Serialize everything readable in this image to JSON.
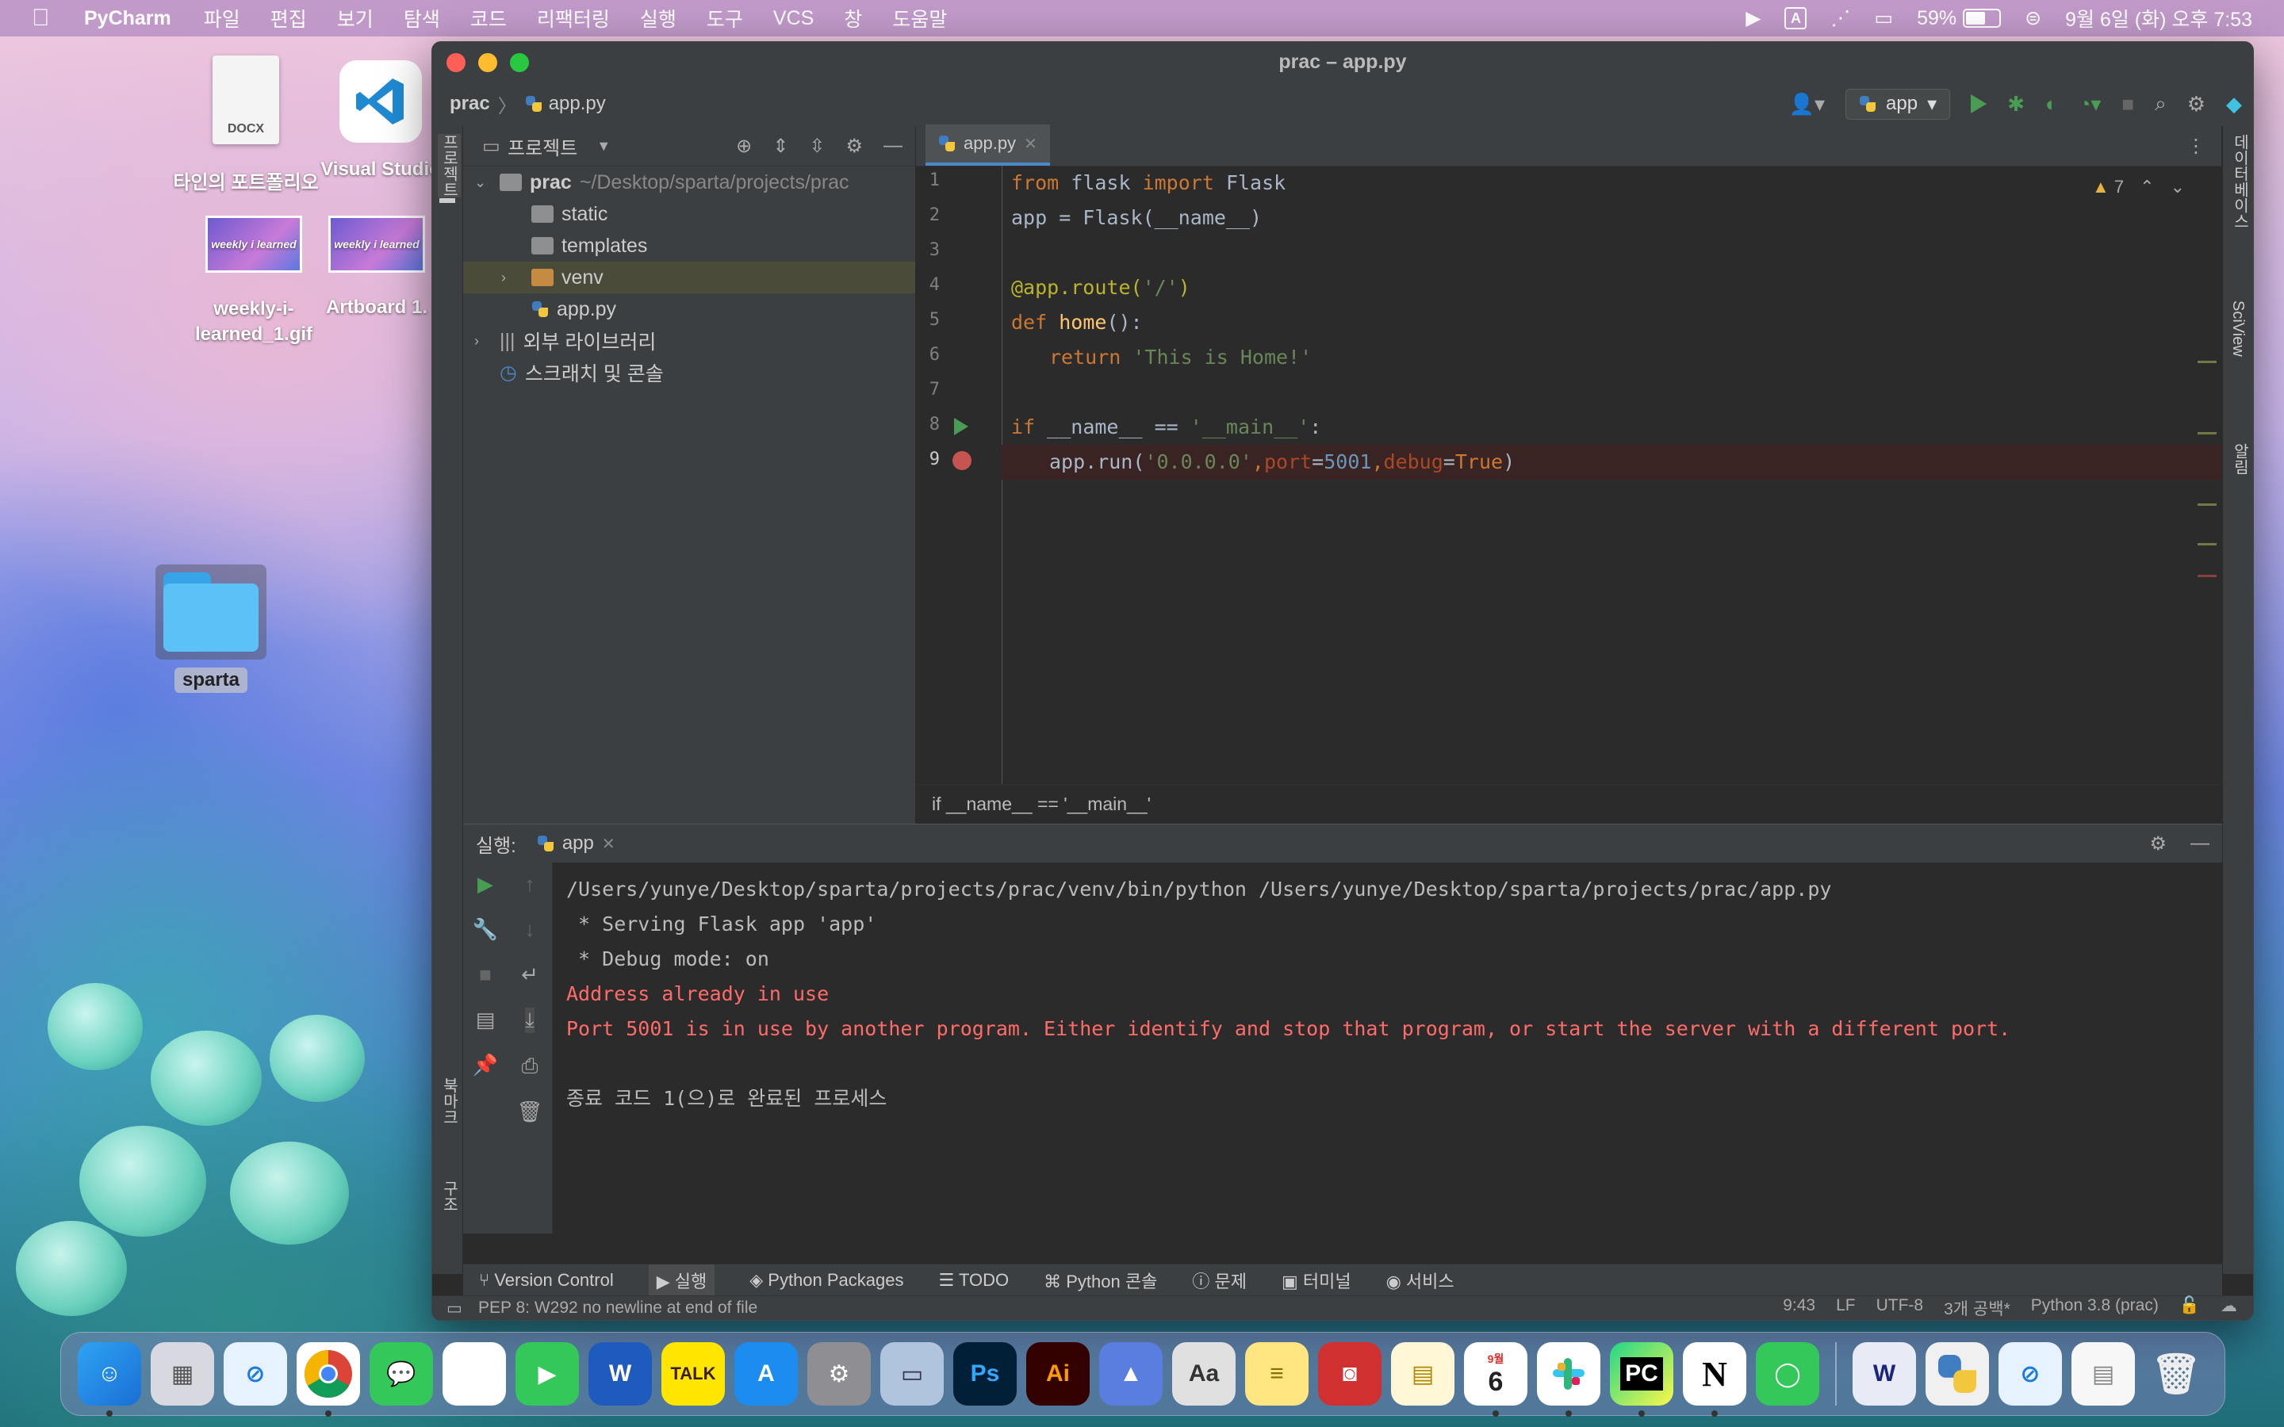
{
  "menubar": {
    "app_name": "PyCharm",
    "items": [
      "파일",
      "편집",
      "보기",
      "탐색",
      "코드",
      "리팩터링",
      "실행",
      "도구",
      "VCS",
      "창",
      "도움말"
    ],
    "input_source": "A",
    "battery_percent": "59%",
    "battery_level": 0.59,
    "clock": "9월 6일 (화) 오후 7:53"
  },
  "desktop": {
    "docx_label": "타인의 포트폴리오",
    "docx_tag": "DOCX",
    "vscode_label": "Visual Studio",
    "gif_label": "weekly-i-learned_1.gif",
    "artboard_label": "Artboard 1.",
    "folder_label": "sparta"
  },
  "window": {
    "title": "prac – app.py",
    "breadcrumb_root": "prac",
    "breadcrumb_file": "app.py",
    "run_config": "app"
  },
  "sidebar": {
    "project_label": "프로젝트",
    "bookmarks_label": "북마크",
    "structure_label": "구조",
    "right_db": "데이터베이스",
    "right_sciview": "SciView",
    "right_notify": "알림"
  },
  "project": {
    "header": "프로젝트",
    "root_name": "prac",
    "root_path": "~/Desktop/sparta/projects/prac",
    "items": [
      "static",
      "templates",
      "venv",
      "app.py"
    ],
    "external_libs": "외부 라이브러리",
    "scratches": "스크래치 및 콘솔"
  },
  "editor": {
    "tab": "app.py",
    "warning_count": "7",
    "line_numbers": [
      "1",
      "2",
      "3",
      "4",
      "5",
      "6",
      "7",
      "8",
      "9"
    ],
    "lines": [
      [
        "from",
        " flask ",
        "import",
        " Flask"
      ],
      [
        "app = Flask(__name__)"
      ],
      [
        ""
      ],
      [
        "@app.route",
        "(",
        "'/'",
        ")"
      ],
      [
        "def",
        " ",
        "home",
        "():"
      ],
      [
        "return",
        " ",
        "'This is Home!'"
      ],
      [
        ""
      ],
      [
        "if",
        " __name__ == ",
        "'__main__'",
        ":"
      ],
      [
        "app.run(",
        "'0.0.0.0'",
        ",",
        "port",
        "=",
        "5001",
        ",",
        "debug",
        "=",
        "True",
        ")"
      ]
    ],
    "breadcrumb": "if __name__ == '__main__'"
  },
  "run": {
    "label": "실행:",
    "tab": "app",
    "output": [
      "/Users/yunye/Desktop/sparta/projects/prac/venv/bin/python /Users/yunye/Desktop/sparta/projects/prac/app.py",
      " * Serving Flask app 'app'",
      " * Debug mode: on",
      "Address already in use",
      "Port 5001 is in use by another program. Either identify and stop that program, or start the server with a different port.",
      "",
      "종료 코드 1(으)로 완료된 프로세스"
    ]
  },
  "tool_tabs": [
    "Version Control",
    "실행",
    "Python Packages",
    "TODO",
    "Python 콘솔",
    "문제",
    "터미널",
    "서비스"
  ],
  "status": {
    "message": "PEP 8: W292 no newline at end of file",
    "position": "9:43",
    "line_sep": "LF",
    "encoding": "UTF-8",
    "indent": "3개 공백*",
    "interpreter": "Python 3.8 (prac)"
  },
  "dock": {
    "calendar_month": "9월",
    "calendar_day": "6",
    "talk_label": "TALK",
    "ps_label": "Ps",
    "ai_label": "Ai",
    "pc_label": "PC",
    "notion_label": "N",
    "word_label": "W"
  }
}
